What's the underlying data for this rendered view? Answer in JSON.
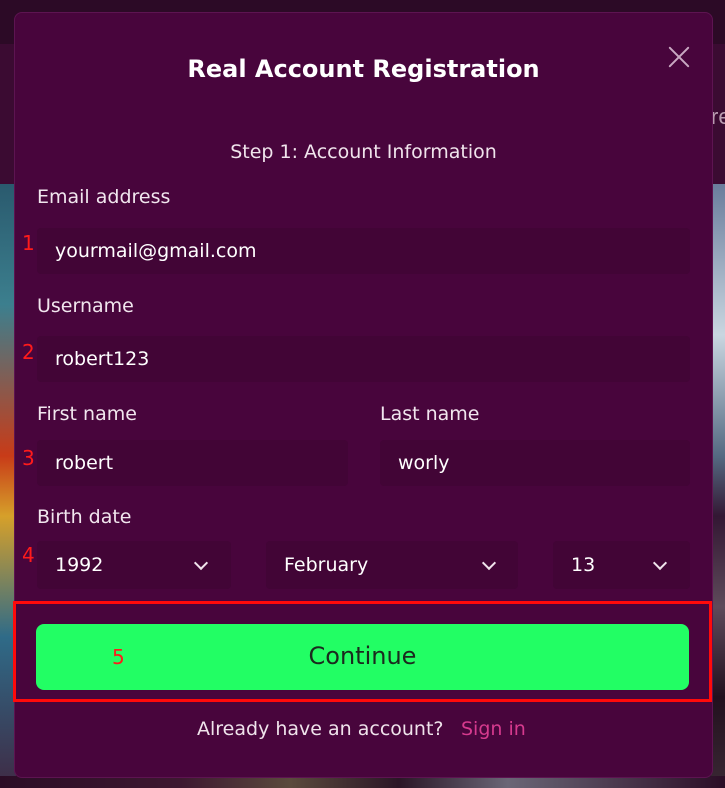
{
  "background": {
    "edge_text": "re"
  },
  "modal": {
    "title": "Real Account Registration",
    "close_icon": "close-icon",
    "step_title": "Step 1: Account Information",
    "email": {
      "label": "Email address",
      "value": "yourmail@gmail.com",
      "marker": "1"
    },
    "username": {
      "label": "Username",
      "value": "robert123",
      "marker": "2"
    },
    "first_name": {
      "label": "First name",
      "value": "robert",
      "marker": "3"
    },
    "last_name": {
      "label": "Last name",
      "value": "worly"
    },
    "birth_date": {
      "label": "Birth date",
      "marker": "4",
      "year": "1992",
      "month": "February",
      "day": "13",
      "chevron_icon": "chevron-down-icon"
    },
    "continue": {
      "label": "Continue",
      "marker": "5",
      "color": "#22fe64"
    },
    "footer": {
      "text": "Already have an account?",
      "link": "Sign in",
      "link_color": "#d63a8e"
    }
  },
  "colors": {
    "modal_bg": "#48053c",
    "field_bg": "#420536",
    "highlight": "#ff0a0a"
  }
}
